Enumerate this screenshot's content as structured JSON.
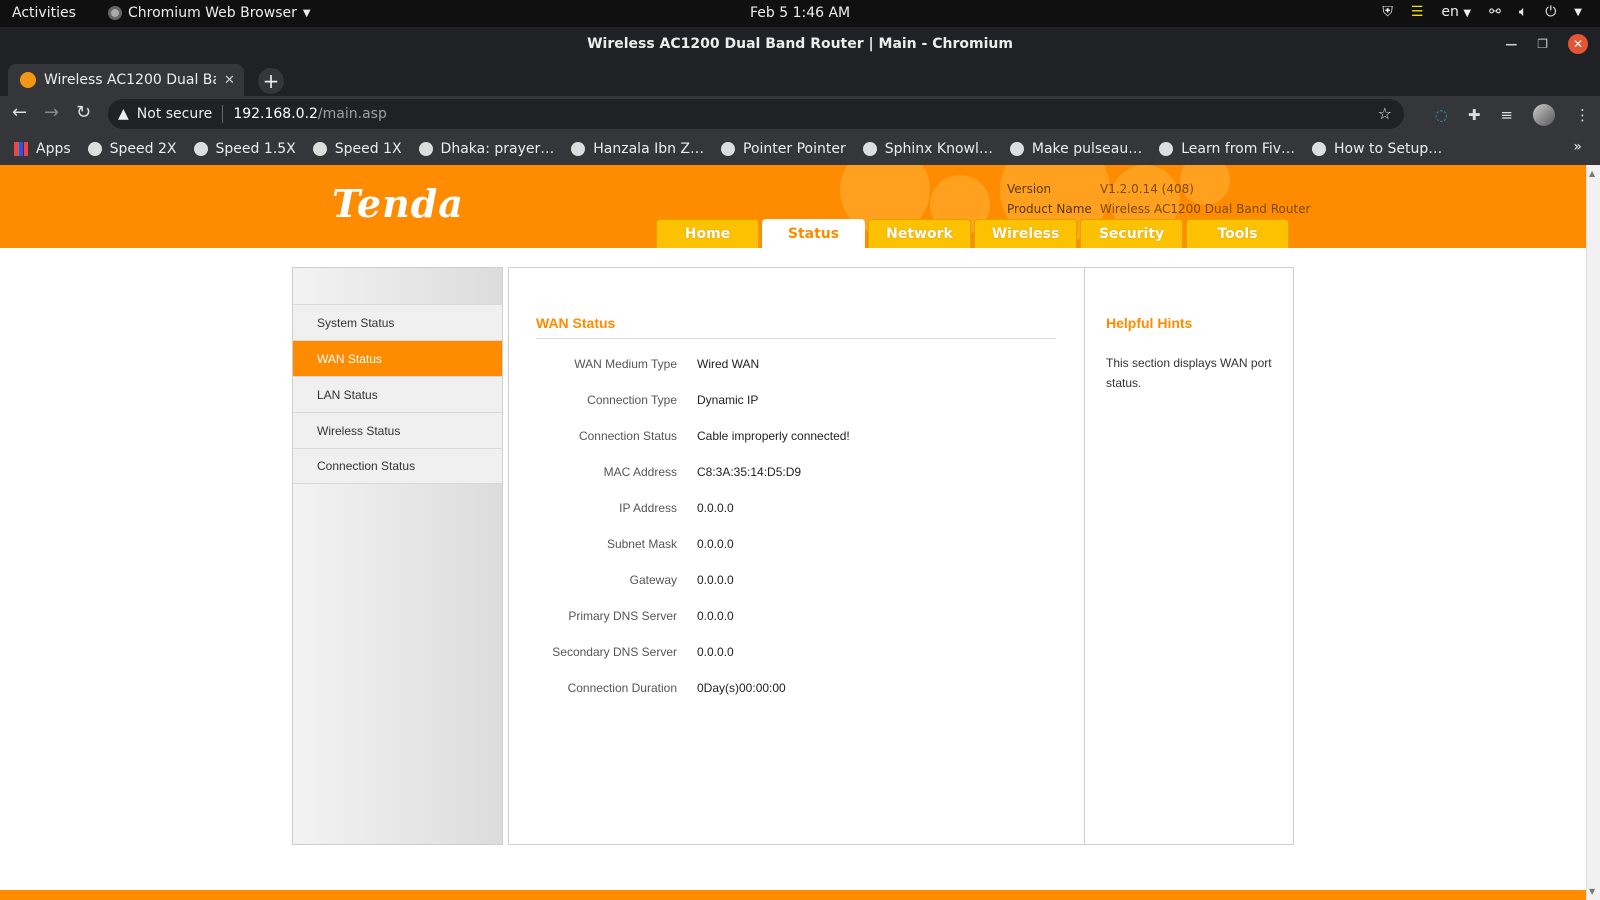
{
  "os_bar": {
    "activities": "Activities",
    "app_name": "Chromium Web Browser",
    "clock": "Feb 5  1:46 AM",
    "lang": "en"
  },
  "window": {
    "title": "Wireless AC1200 Dual Band Router | Main - Chromium"
  },
  "browser": {
    "tab_title": "Wireless AC1200 Dual Band Router | Main",
    "security_label": "Not secure",
    "url_host": "192.168.0.2",
    "url_path": "/main.asp",
    "bookmarks": [
      {
        "label": "Apps",
        "icon": "apps-grid-icon"
      },
      {
        "label": "Speed 2X",
        "icon": "speed-icon"
      },
      {
        "label": "Speed 1.5X",
        "icon": "speed-icon"
      },
      {
        "label": "Speed 1X",
        "icon": "speed-icon"
      },
      {
        "label": "Dhaka: prayer…",
        "icon": "mosque-icon"
      },
      {
        "label": "Hanzala Ibn Z…",
        "icon": "site-icon"
      },
      {
        "label": "Pointer Pointer",
        "icon": "speed-icon"
      },
      {
        "label": "Sphinx Knowl…",
        "icon": "site-icon"
      },
      {
        "label": "Make pulseau…",
        "icon": "github-icon"
      },
      {
        "label": "Learn from Fiv…",
        "icon": "site-icon"
      },
      {
        "label": "How to Setup…",
        "icon": "site-icon"
      }
    ]
  },
  "router": {
    "logo": "Tenda",
    "version_label": "Version",
    "version_value": "V1.2.0.14 (408)",
    "product_label": "Product Name",
    "product_value": "Wireless AC1200 Dual Band Router",
    "nav_tabs": [
      "Home",
      "Status",
      "Network",
      "Wireless",
      "Security",
      "Tools"
    ],
    "active_tab": "Status",
    "sidebar": [
      "System Status",
      "WAN Status",
      "LAN Status",
      "Wireless Status",
      "Connection Status"
    ],
    "active_sidebar": "WAN Status",
    "section_title": "WAN Status",
    "fields": [
      {
        "label": "WAN Medium Type",
        "value": "Wired WAN"
      },
      {
        "label": "Connection Type",
        "value": "Dynamic IP"
      },
      {
        "label": "Connection Status",
        "value": "Cable improperly connected!"
      },
      {
        "label": "MAC Address",
        "value": "C8:3A:35:14:D5:D9"
      },
      {
        "label": "IP Address",
        "value": "0.0.0.0"
      },
      {
        "label": "Subnet Mask",
        "value": "0.0.0.0"
      },
      {
        "label": "Gateway",
        "value": "0.0.0.0"
      },
      {
        "label": "Primary DNS Server",
        "value": "0.0.0.0"
      },
      {
        "label": "Secondary DNS Server",
        "value": "0.0.0.0"
      },
      {
        "label": "Connection Duration",
        "value": "0Day(s)00:00:00"
      }
    ],
    "hints_title": "Helpful Hints",
    "hints_text": "This section displays WAN port status."
  },
  "colors": {
    "brand_orange": "#ff8c00",
    "tab_yellow": "#fcc100"
  }
}
